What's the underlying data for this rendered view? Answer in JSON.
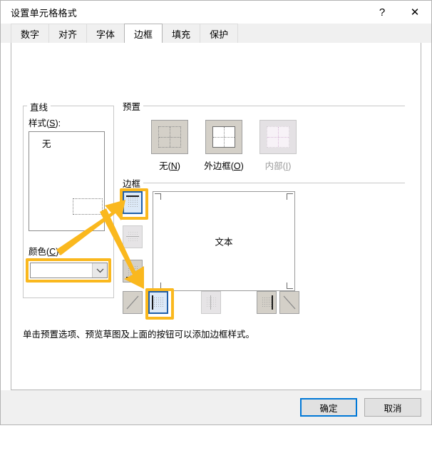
{
  "window": {
    "title": "设置单元格格式",
    "help_button": "?",
    "close_button": "✕"
  },
  "tabs": [
    {
      "label": "数字",
      "active": false
    },
    {
      "label": "对齐",
      "active": false
    },
    {
      "label": "字体",
      "active": false
    },
    {
      "label": "边框",
      "active": true
    },
    {
      "label": "填充",
      "active": false
    },
    {
      "label": "保护",
      "active": false
    }
  ],
  "line_group": {
    "legend": "直线",
    "style_label": "样式(S):",
    "style_accel": "S",
    "style_items": [
      "无"
    ],
    "selected_style": "无",
    "color_label": "颜色(C):",
    "color_accel": "C",
    "color_value": "",
    "color_dropdown_icon": "chevron-down-icon"
  },
  "preset_group": {
    "legend": "预置",
    "buttons": [
      {
        "label": "无(N)",
        "accel": "N",
        "enabled": true,
        "icon": "preset-none-icon"
      },
      {
        "label": "外边框(O)",
        "accel": "O",
        "enabled": true,
        "icon": "preset-outline-icon"
      },
      {
        "label": "内部(I)",
        "accel": "I",
        "enabled": false,
        "icon": "preset-inside-icon"
      }
    ]
  },
  "border_group": {
    "legend": "边框",
    "left_buttons": [
      {
        "icon": "border-top-icon",
        "selected": true,
        "enabled": true,
        "highlighted": true
      },
      {
        "icon": "border-horizontal-middle-icon",
        "selected": false,
        "enabled": false,
        "highlighted": false
      },
      {
        "icon": "border-bottom-icon",
        "selected": false,
        "enabled": true,
        "highlighted": false
      }
    ],
    "bottom_buttons": [
      {
        "icon": "border-diagonal-up-icon",
        "selected": false,
        "enabled": true,
        "highlighted": false
      },
      {
        "icon": "border-left-icon",
        "selected": true,
        "enabled": true,
        "highlighted": true
      },
      {
        "icon": "border-vertical-middle-icon",
        "selected": false,
        "enabled": false,
        "highlighted": false
      },
      {
        "icon": "border-right-icon",
        "selected": false,
        "enabled": true,
        "highlighted": false
      },
      {
        "icon": "border-diagonal-down-icon",
        "selected": false,
        "enabled": true,
        "highlighted": false
      }
    ],
    "preview_text": "文本"
  },
  "hint": "单击预置选项、预览草图及上面的按钮可以添加边框样式。",
  "footer": {
    "ok_label": "确定",
    "cancel_label": "取消"
  },
  "annotations": {
    "arrow_color": "#FAB81E",
    "highlight_color": "#FAB81E",
    "arrows": [
      {
        "name": "arrow-to-top-border-button",
        "from": [
          95,
          305
        ],
        "to": [
          168,
          238
        ]
      },
      {
        "name": "arrow-to-bottom-left-border-button",
        "from": [
          178,
          243
        ],
        "to": [
          212,
          350
        ]
      }
    ]
  },
  "colors": {
    "accent": "#0078d7",
    "selection": "#dce9f7",
    "selection_border": "#1f5fa9",
    "dialog_bg": "#ffffff",
    "tabstrip_bg": "#f0f0f0",
    "footer_bg": "#f0f0f0",
    "button_face": "#d4d0c8"
  }
}
